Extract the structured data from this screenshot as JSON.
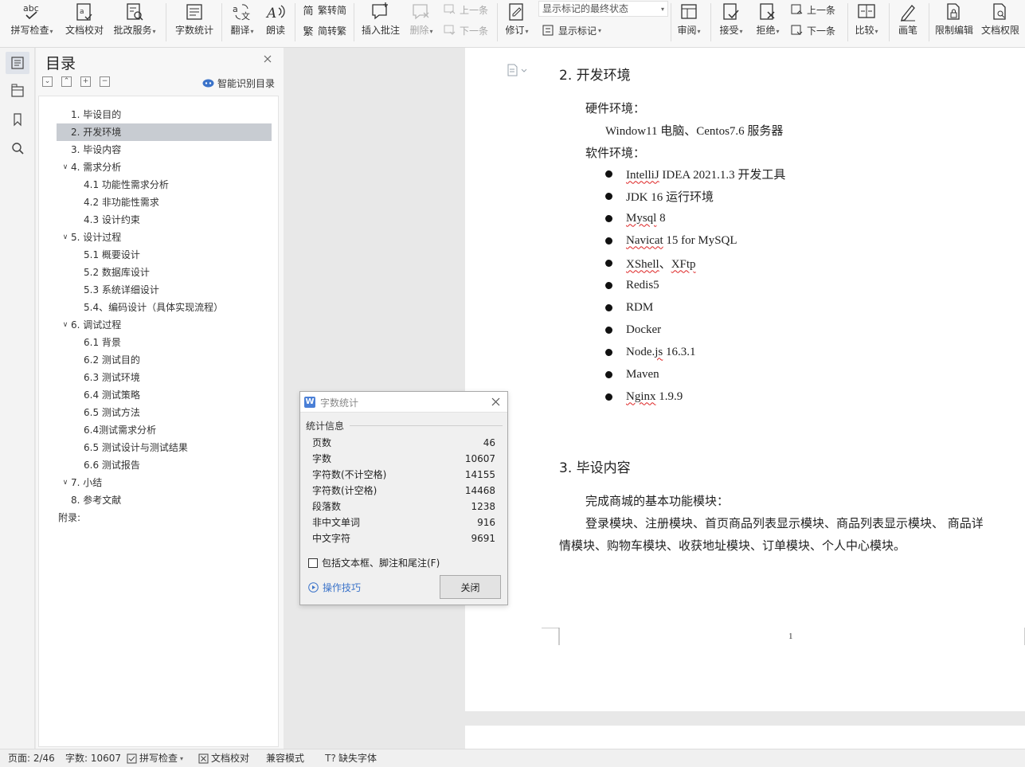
{
  "ribbon": {
    "spell_check": "拼写检查",
    "doc_proofread": "文档校对",
    "revision_service": "批改服务",
    "word_count": "字数统计",
    "translate": "翻译",
    "read_aloud": "朗读",
    "to_simplified": "繁转简",
    "to_traditional": "简转繁",
    "insert_comment": "插入批注",
    "delete": "删除",
    "prev_comment": "上一条",
    "next_comment": "下一条",
    "track_changes": "修订",
    "markup_state": "显示标记的最终状态",
    "show_markup": "显示标记",
    "review": "审阅",
    "accept": "接受",
    "reject": "拒绝",
    "prev_change": "上一条",
    "next_change": "下一条",
    "compare": "比较",
    "pen": "画笔",
    "restrict_edit": "限制编辑",
    "doc_permission": "文档权限"
  },
  "toc": {
    "title": "目录",
    "smart_detect": "智能识别目录",
    "items": [
      {
        "label": "1.  毕设目的",
        "toggle": ""
      },
      {
        "label": "2.  开发环境",
        "toggle": ""
      },
      {
        "label": "3.  毕设内容",
        "toggle": ""
      },
      {
        "label": "4.  需求分析",
        "toggle": "∨"
      },
      {
        "label": "4.1 功能性需求分析",
        "toggle": ""
      },
      {
        "label": "4.2 非功能性需求",
        "toggle": ""
      },
      {
        "label": "4.3 设计约束",
        "toggle": ""
      },
      {
        "label": "5.  设计过程",
        "toggle": "∨"
      },
      {
        "label": "5.1 概要设计",
        "toggle": ""
      },
      {
        "label": "5.2 数据库设计",
        "toggle": ""
      },
      {
        "label": "5.3 系统详细设计",
        "toggle": ""
      },
      {
        "label": "5.4、编码设计（具体实现流程）",
        "toggle": ""
      },
      {
        "label": "6.  调试过程",
        "toggle": "∨"
      },
      {
        "label": "6.1  背景",
        "toggle": ""
      },
      {
        "label": "6.2  测试目的",
        "toggle": ""
      },
      {
        "label": "6.3 测试环境",
        "toggle": ""
      },
      {
        "label": "6.4  测试策略",
        "toggle": ""
      },
      {
        "label": "6.5  测试方法",
        "toggle": ""
      },
      {
        "label": "6.4测试需求分析",
        "toggle": ""
      },
      {
        "label": "6.5  测试设计与测试结果",
        "toggle": ""
      },
      {
        "label": "6.6  测试报告",
        "toggle": ""
      },
      {
        "label": "7.  小结",
        "toggle": "∨"
      },
      {
        "label": "8.  参考文献",
        "toggle": ""
      },
      {
        "label": "附录:",
        "toggle": ""
      }
    ]
  },
  "document": {
    "h2": "2.  开发环境",
    "hw_label": "硬件环境：",
    "hw_value": "Window11  电脑、Centos7.6  服务器",
    "sw_label": "软件环境：",
    "software": [
      {
        "name": "IntelliJ",
        "rest": " IDEA 2021.1.3  开发工具"
      },
      {
        "name": "",
        "rest": "JDK 16  运行环境"
      },
      {
        "name": "Mysql",
        "rest": " 8"
      },
      {
        "name": "Navicat",
        "rest": " 15 for MySQL"
      },
      {
        "name": "XShell",
        "rest": "、",
        "name2": "XFtp"
      },
      {
        "name": "",
        "rest": "Redis5"
      },
      {
        "name": "",
        "rest": "RDM"
      },
      {
        "name": "",
        "rest": "Docker"
      },
      {
        "name": "",
        "rest": "Node.",
        "name2": "js",
        "rest2": " 16.3.1"
      },
      {
        "name": "",
        "rest": "Maven"
      },
      {
        "name": "Nginx",
        "rest": " 1.9.9"
      }
    ],
    "h3": "3.  毕设内容",
    "p1": "完成商城的基本功能模块：",
    "p2": "登录模块、注册模块、首页商品列表显示模块、商品列表显示模块、  商品详",
    "p3": "情模块、购物车模块、收获地址模块、订单模块、个人中心模块。",
    "page_number": "1"
  },
  "dialog": {
    "title": "字数统计",
    "group": "统计信息",
    "stats": [
      {
        "k": "页数",
        "v": "46"
      },
      {
        "k": "字数",
        "v": "10607"
      },
      {
        "k": "字符数(不计空格)",
        "v": "14155"
      },
      {
        "k": "字符数(计空格)",
        "v": "14468"
      },
      {
        "k": "段落数",
        "v": "1238"
      },
      {
        "k": "非中文单词",
        "v": "916"
      },
      {
        "k": "中文字符",
        "v": "9691"
      }
    ],
    "include_label": "包括文本框、脚注和尾注(F)",
    "tips": "操作技巧",
    "close": "关闭"
  },
  "status": {
    "page": "页面: 2/46",
    "words": "字数: 10607",
    "spell": "拼写检查",
    "proof": "文档校对",
    "compat": "兼容模式",
    "missing_font": "缺失字体"
  },
  "colors": {
    "accent": "#3b73c9",
    "selected_toc": "#c8ccd2",
    "squiggle": "#dd2222"
  }
}
